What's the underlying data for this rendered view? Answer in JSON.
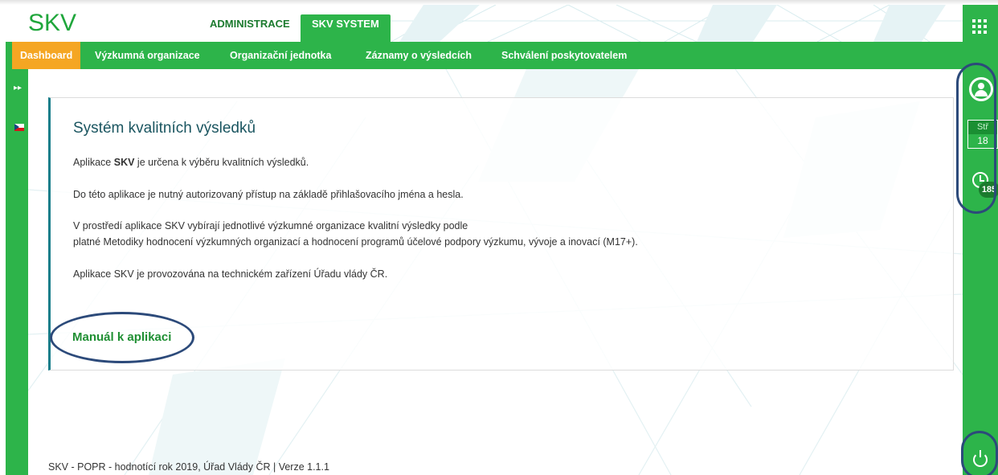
{
  "header": {
    "logo": "SKV",
    "tabs": [
      {
        "label": "ADMINISTRACE"
      },
      {
        "label": "SKV SYSTEM"
      }
    ]
  },
  "nav": {
    "items": [
      {
        "label": "Dashboard",
        "active": true
      },
      {
        "label": "Výzkumná organizace"
      },
      {
        "label": "Organizační jednotka"
      },
      {
        "label": "Záznamy o výsledcích"
      },
      {
        "label": "Schválení poskytovatelem"
      }
    ]
  },
  "right_sidebar": {
    "calendar_day": "Stř",
    "calendar_date": "18",
    "clock_badge": "185"
  },
  "card": {
    "title": "Systém kvalitních výsledků",
    "p1_before": "Aplikace ",
    "p1_bold": "SKV",
    "p1_after": " je určena k výběru kvalitních výsledků.",
    "p2": "Do této aplikace je nutný autorizovaný přístup na základě přihlašovacího jména a hesla.",
    "p3_line1": "V prostředí aplikace SKV vybírají jednotlivé výzkumné organizace kvalitní výsledky podle",
    "p3_line2": "platné Metodiky hodnocení výzkumných organizací a hodnocení programů účelové podpory výzkumu, vývoje a inovací (M17+).",
    "p4": "Aplikace SKV je provozována na technickém zařízení Úřadu vlády ČR.",
    "manual_link": "Manuál k aplikaci"
  },
  "footer": {
    "text": "SKV - POPR - hodnotící rok 2019, Úřad Vlády ČR | Verze 1.1.1"
  },
  "colors": {
    "primary_green": "#2db44a",
    "active_tab": "#f5a623",
    "title_teal": "#1a5560",
    "link_green": "#1f8f33",
    "annotation_oval": "#2c4a7a"
  }
}
